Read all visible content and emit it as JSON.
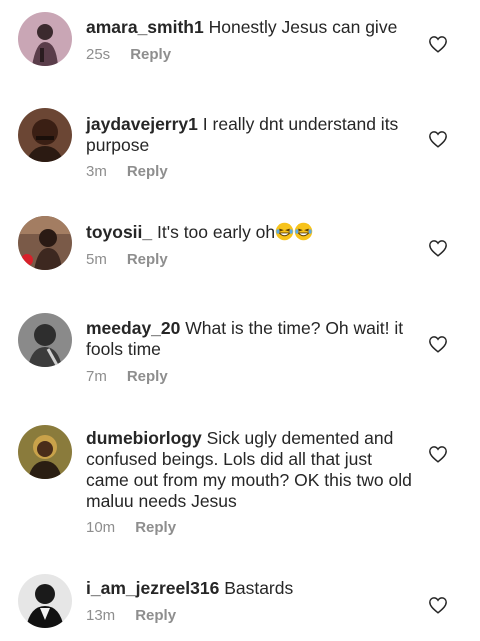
{
  "comments": [
    {
      "username": "amara_smith1",
      "text": "Honestly Jesus can give",
      "time": "25s",
      "reply": "Reply"
    },
    {
      "username": "jaydavejerry1",
      "text": "I really dnt understand its purpose",
      "time": "3m",
      "reply": "Reply"
    },
    {
      "username": "toyosii_",
      "text": "It's too early oh",
      "time": "5m",
      "reply": "Reply",
      "emojis": [
        "grinning-squinting-tears-emoji",
        "grinning-squinting-tears-emoji"
      ]
    },
    {
      "username": "meeday_20",
      "text": "What is the time? Oh wait! it fools time",
      "time": "7m",
      "reply": "Reply"
    },
    {
      "username": "dumebiorlogy",
      "text": "Sick ugly demented and confused beings. Lols did all that just came out from my mouth? OK this two old maluu needs Jesus",
      "time": "10m",
      "reply": "Reply"
    },
    {
      "username": "i_am_jezreel316",
      "text": "Bastards",
      "time": "13m",
      "reply": "Reply"
    }
  ],
  "icons": {
    "like": "heart-outline-icon"
  },
  "colors": {
    "text": "#262626",
    "muted": "#8e8e8e",
    "background": "#ffffff"
  }
}
